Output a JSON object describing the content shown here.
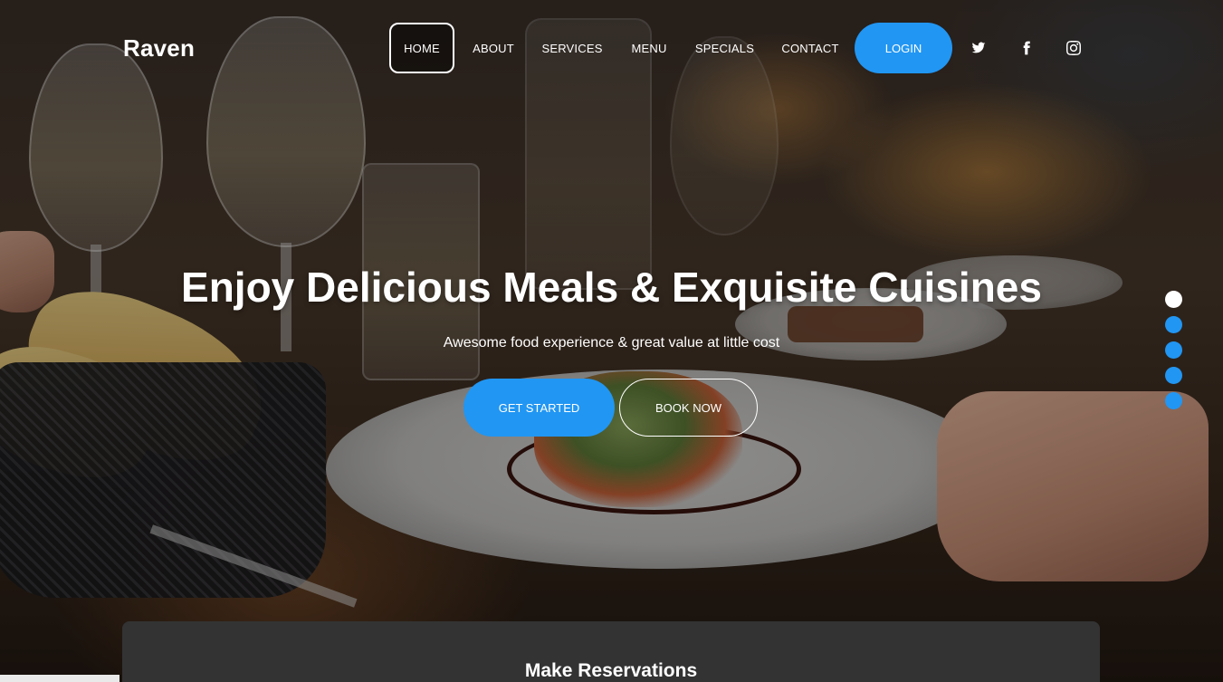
{
  "brand": {
    "name": "Raven",
    "accent": "#2196f3"
  },
  "nav": {
    "items": [
      {
        "label": "HOME",
        "active": true
      },
      {
        "label": "ABOUT"
      },
      {
        "label": "SERVICES"
      },
      {
        "label": "MENU"
      },
      {
        "label": "SPECIALS"
      },
      {
        "label": "CONTACT"
      }
    ],
    "login_label": "LOGIN"
  },
  "social": [
    "twitter-icon",
    "facebook-icon",
    "instagram-icon"
  ],
  "hero": {
    "title": "Enjoy Delicious Meals & Exquisite Cuisines",
    "subtitle": "Awesome food experience & great value at little cost",
    "primary_button": "GET STARTED",
    "secondary_button": "BOOK NOW",
    "slide_count": 5,
    "active_slide": 1
  },
  "reservation": {
    "title": "Make Reservations"
  }
}
